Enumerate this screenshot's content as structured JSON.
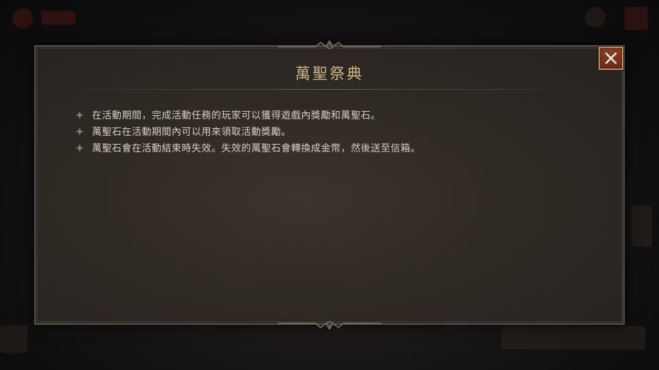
{
  "dialog": {
    "title": "萬聖祭典",
    "bullets": [
      "在活動期間，完成活動任務的玩家可以獲得遊戲內獎勵和萬聖石。",
      "萬聖石在活動期間內可以用來領取活動獎勵。",
      "萬聖石會在活動結束時失效。失效的萬聖石會轉換成金幣，然後送至信箱。"
    ],
    "close_icon": "close-x-icon",
    "bullet_icon": "diamond-bullet-icon"
  },
  "colors": {
    "panel_bg": "#302a24",
    "title": "#cdb58a",
    "body_text": "#d6d0c6",
    "close_bg": "#7a3522",
    "close_border": "#b6926a"
  }
}
